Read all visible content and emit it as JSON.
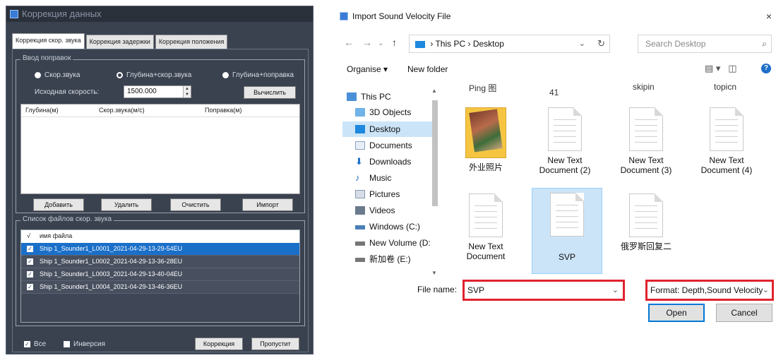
{
  "left": {
    "title": "Коррекция данных",
    "tabs": [
      "Коррекция скор. звука",
      "Коррекция задержки",
      "Коррекция положения"
    ],
    "input_group": {
      "legend": "Ввод поправок",
      "radio1": "Скор.звука",
      "radio2": "Глубина+скор.звука",
      "radio3": "Глубина+поправка",
      "source_speed_label": "Исходная скорость:",
      "source_speed_value": "1500.000",
      "calc_button": "Вычислить",
      "columns": [
        "Глубина(м)",
        "Скор.звука(м/с)",
        "Поправка(м)"
      ],
      "add_button": "Добавить",
      "delete_button": "Удалить",
      "clear_button": "Очистить",
      "import_button": "Импорт"
    },
    "file_group": {
      "legend": "Список файлов скор. звука",
      "check_header": "√",
      "name_header": "имя файла",
      "files": [
        "Ship 1_Sounder1_L0001_2021-04-29-13-29-54EU",
        "Ship 1_Sounder1_L0002_2021-04-29-13-36-28EU",
        "Ship 1_Sounder1_L0003_2021-04-29-13-40-04EU",
        "Ship 1_Sounder1_L0004_2021-04-29-13-46-36EU"
      ],
      "check_mark": "✓"
    },
    "all_label": "Все",
    "invert_label": "Инверсия",
    "correct_button": "Коррекция",
    "skip_button": "Пропустит"
  },
  "dialog": {
    "title": "Import Sound Velocity File",
    "close": "×",
    "breadcrumb_sep": "›",
    "this_pc": "This PC",
    "desktop": "Desktop",
    "search_placeholder": "Search Desktop",
    "organise": "Organise ▾",
    "new_folder": "New folder",
    "nav_items": [
      "This PC",
      "3D Objects",
      "Desktop",
      "Documents",
      "Downloads",
      "Music",
      "Pictures",
      "Videos",
      "Windows (C:)",
      "New Volume (D:",
      "新加卷 (E:)"
    ],
    "cutoff_top": [
      "Ping 图",
      "41",
      "skipin",
      "topicn"
    ],
    "files": [
      {
        "name": "外业照片",
        "kind": "folder"
      },
      {
        "name": "New Text\nDocument (2)",
        "kind": "doc"
      },
      {
        "name": "New Text\nDocument (3)",
        "kind": "doc"
      },
      {
        "name": "New Text\nDocument (4)",
        "kind": "doc"
      },
      {
        "name": "New Text\nDocument",
        "kind": "doc"
      },
      {
        "name": "SVP",
        "kind": "doc"
      },
      {
        "name": "俄罗斯回复二",
        "kind": "doc"
      }
    ],
    "file_name_label": "File name:",
    "file_name_value": "SVP",
    "format_value": "Format: Depth,Sound Velocity.",
    "open_button": "Open",
    "cancel_button": "Cancel"
  },
  "colors": {
    "highlight": "#e0232f",
    "selection": "#1a6fc9",
    "panel": "#3a4250"
  }
}
